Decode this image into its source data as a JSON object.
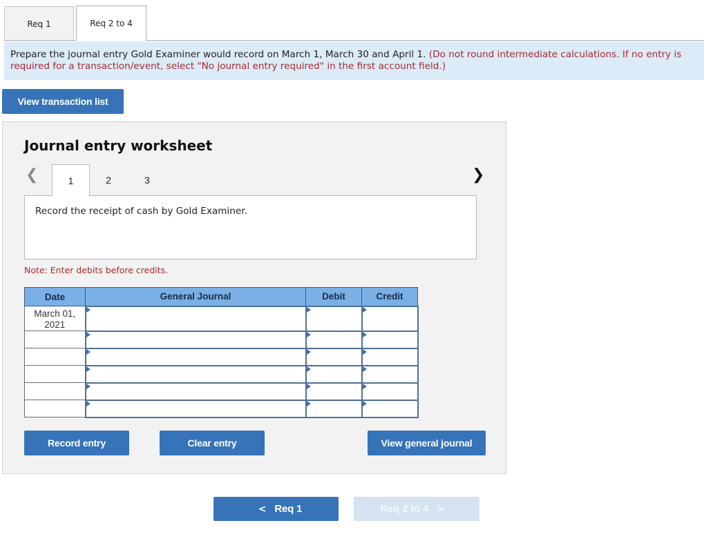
{
  "tabs": [
    {
      "label": "Req 1",
      "active": false
    },
    {
      "label": "Req 2 to 4",
      "active": true
    }
  ],
  "instructions": {
    "main": "Prepare the journal entry Gold Examiner would record on March 1, March 30 and April 1.",
    "note": "(Do not round intermediate calculations. If no entry is required for a transaction/event, select \"No journal entry required\" in the first account field.)"
  },
  "view_transaction_list_label": "View transaction list",
  "worksheet": {
    "title": "Journal entry worksheet",
    "prev_icon": "chevron-left-icon",
    "next_icon": "chevron-right-icon",
    "steps": [
      "1",
      "2",
      "3"
    ],
    "active_step": "1",
    "description": "Record the receipt of cash by Gold Examiner.",
    "note": "Note: Enter debits before credits.",
    "table": {
      "headers": [
        "Date",
        "General Journal",
        "Debit",
        "Credit"
      ],
      "rows": [
        {
          "date": "March 01, 2021",
          "account": "",
          "debit": "",
          "credit": ""
        },
        {
          "date": "",
          "account": "",
          "debit": "",
          "credit": ""
        },
        {
          "date": "",
          "account": "",
          "debit": "",
          "credit": ""
        },
        {
          "date": "",
          "account": "",
          "debit": "",
          "credit": ""
        },
        {
          "date": "",
          "account": "",
          "debit": "",
          "credit": ""
        },
        {
          "date": "",
          "account": "",
          "debit": "",
          "credit": ""
        }
      ]
    },
    "buttons": {
      "record": "Record entry",
      "clear": "Clear entry",
      "view_journal": "View general journal"
    }
  },
  "footer_nav": {
    "prev_label": "Req 1",
    "next_label": "Req 2 to 4",
    "next_disabled": true
  },
  "colors": {
    "primary_button": "#3673b8",
    "disabled_button": "#d4e2f1",
    "instruction_bg": "#dcebf8",
    "warning_text": "#a42a31",
    "table_header": "#7ab0e6"
  }
}
